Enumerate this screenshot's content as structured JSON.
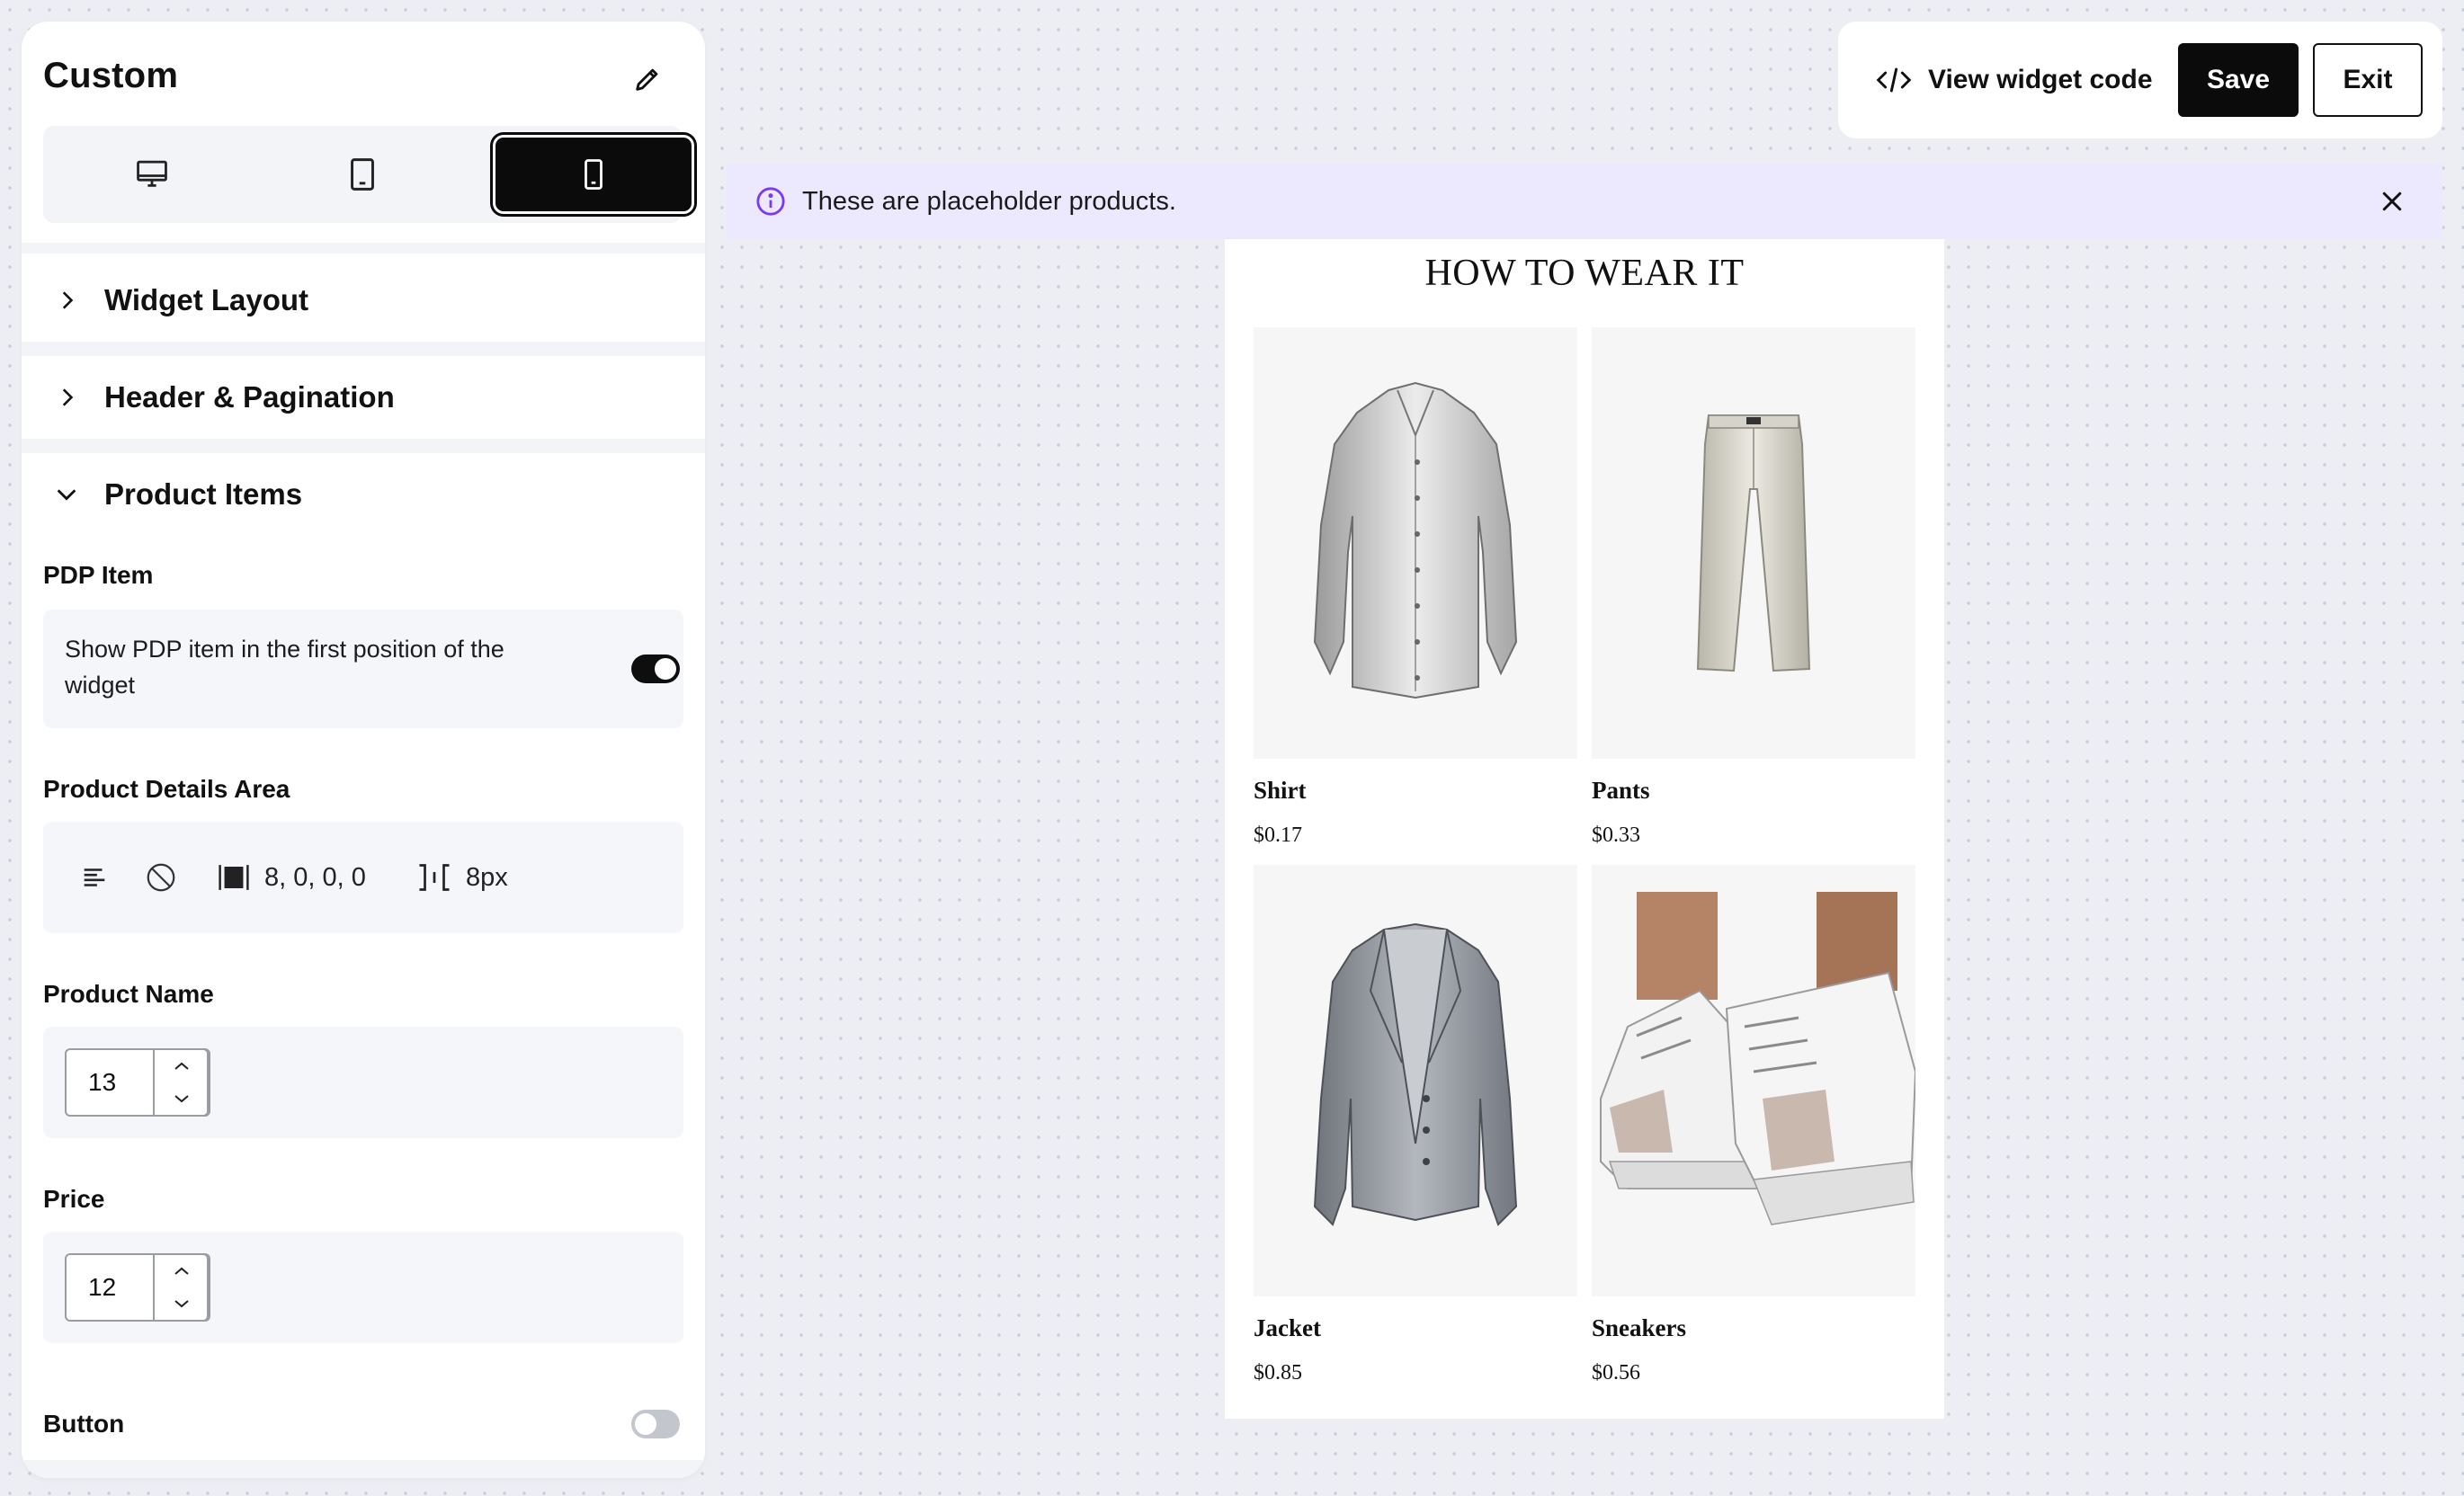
{
  "sidebar": {
    "title": "Custom",
    "edit_icon": "pencil-icon",
    "devices": [
      {
        "name": "desktop",
        "icon": "desktop-icon",
        "selected": false
      },
      {
        "name": "tablet",
        "icon": "tablet-icon",
        "selected": false
      },
      {
        "name": "mobile",
        "icon": "mobile-icon",
        "selected": true
      }
    ],
    "sections": {
      "widget_layout": "Widget Layout",
      "header_pagination": "Header & Pagination",
      "product_items": "Product Items"
    },
    "pdp_item": {
      "label": "PDP Item",
      "description": "Show PDP item in the first position of the widget",
      "enabled": true
    },
    "product_details_area": {
      "label": "Product Details Area",
      "padding_value": "8, 0, 0, 0",
      "gap_value": "8px"
    },
    "product_name": {
      "label": "Product Name",
      "font_size": "13"
    },
    "price": {
      "label": "Price",
      "font_size": "12"
    },
    "button": {
      "label": "Button",
      "enabled": false
    }
  },
  "topbar": {
    "view_code_label": "View widget code",
    "save_label": "Save",
    "exit_label": "Exit"
  },
  "notice": {
    "text": "These are placeholder products."
  },
  "preview": {
    "title": "HOW TO WEAR IT",
    "products": [
      {
        "name": "Shirt",
        "price": "$0.17"
      },
      {
        "name": "Pants",
        "price": "$0.33"
      },
      {
        "name": "Jacket",
        "price": "$0.85"
      },
      {
        "name": "Sneakers",
        "price": "$0.56"
      }
    ]
  },
  "colors": {
    "accent": "#0b0b0b",
    "notice_bg": "#ece9ff",
    "info_icon": "#7c3aed",
    "canvas_bg": "#eceef4"
  }
}
